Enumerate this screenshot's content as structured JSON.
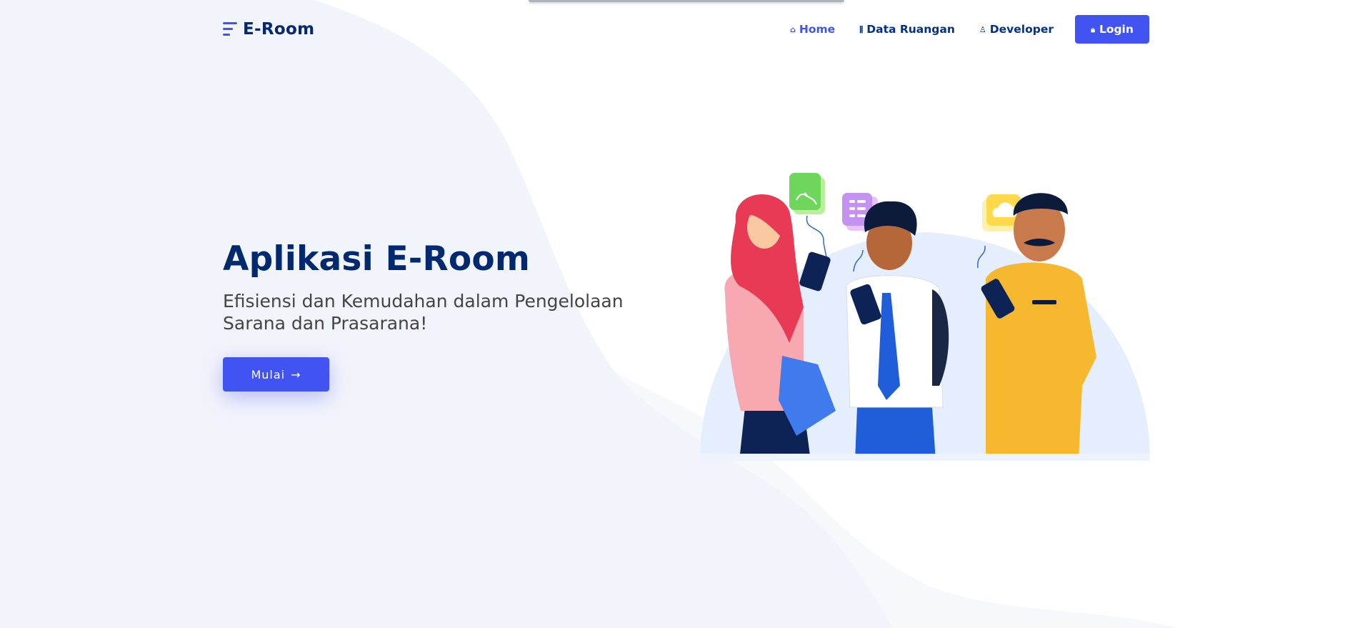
{
  "header": {
    "brand": "E-Room",
    "nav": [
      {
        "label": "Home",
        "icon": "house-icon",
        "active": true
      },
      {
        "label": "Data Ruangan",
        "icon": "library-icon",
        "active": false
      },
      {
        "label": "Developer",
        "icon": "person-icon",
        "active": false
      }
    ],
    "login_label": "Login"
  },
  "hero": {
    "title": "Aplikasi E-Room",
    "subtitle": "Efisiensi dan Kemudahan dalam Pengelolaan Sarana dan Prasarana!",
    "cta_label": "Mulai"
  },
  "colors": {
    "primary": "#4154f1",
    "heading": "#012970",
    "nav_text": "#013289",
    "background_wave": "#f0f3fb"
  }
}
